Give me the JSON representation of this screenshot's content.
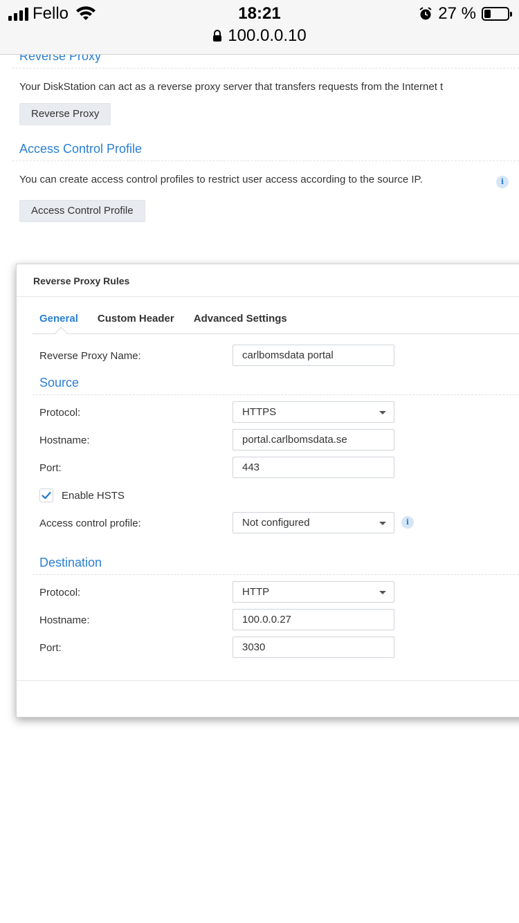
{
  "status_bar": {
    "carrier": "Fello",
    "time": "18:21",
    "battery_percent": "27 %",
    "battery_level": 0.27,
    "url": "100.0.0.10"
  },
  "page": {
    "reverse_proxy": {
      "title": "Reverse Proxy",
      "description": "Your DiskStation can act as a reverse proxy server that transfers requests from the Internet t",
      "button": "Reverse Proxy"
    },
    "access_control": {
      "title": "Access Control Profile",
      "description": "You can create access control profiles to restrict user access according to the source IP.",
      "button": "Access Control Profile",
      "info_glyph": "i"
    }
  },
  "dialog": {
    "title": "Reverse Proxy Rules",
    "tabs": [
      {
        "label": "General",
        "active": true
      },
      {
        "label": "Custom Header",
        "active": false
      },
      {
        "label": "Advanced Settings",
        "active": false
      }
    ],
    "name_label": "Reverse Proxy Name:",
    "name_value": "carlbomsdata portal",
    "source": {
      "title": "Source",
      "protocol_label": "Protocol:",
      "protocol_value": "HTTPS",
      "hostname_label": "Hostname:",
      "hostname_value": "portal.carlbomsdata.se",
      "port_label": "Port:",
      "port_value": "443",
      "hsts_label": "Enable HSTS",
      "hsts_checked": true,
      "acp_label": "Access control profile:",
      "acp_value": "Not configured",
      "info_glyph": "i"
    },
    "destination": {
      "title": "Destination",
      "protocol_label": "Protocol:",
      "protocol_value": "HTTP",
      "hostname_label": "Hostname:",
      "hostname_value": "100.0.0.27",
      "port_label": "Port:",
      "port_value": "3030"
    }
  },
  "colors": {
    "accent": "#2a7fd3",
    "button_bg": "#e8ebef"
  }
}
